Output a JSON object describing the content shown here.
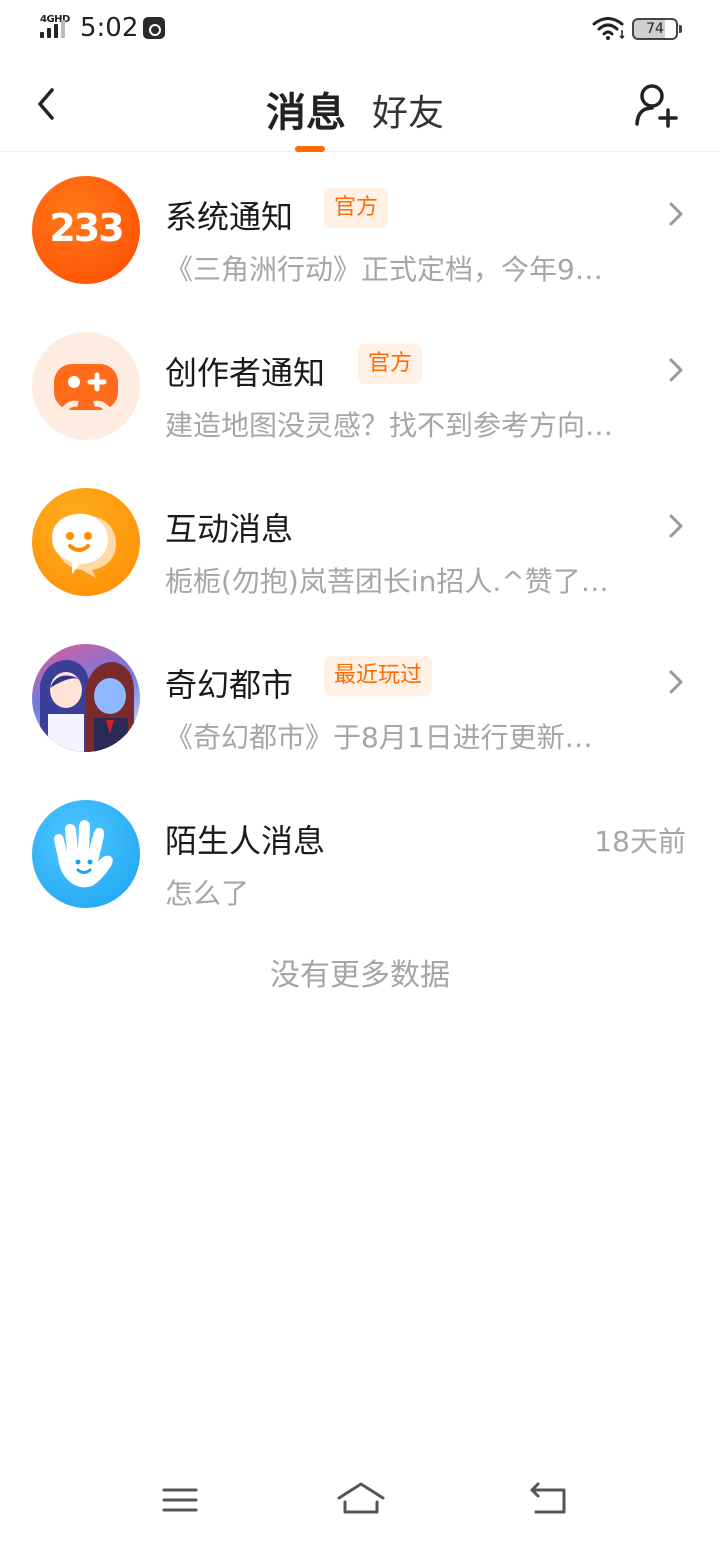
{
  "status_bar": {
    "network": "4GHD",
    "time": "5:02",
    "battery": "74"
  },
  "header": {
    "tabs": [
      {
        "label": "消息",
        "active": true
      },
      {
        "label": "好友",
        "active": false
      }
    ],
    "accent_color": "#ff6b00",
    "icons": {
      "back": "chevron-left-icon",
      "add_friend": "add-user-icon"
    }
  },
  "messages": [
    {
      "title": "系统通知",
      "tag": "官方",
      "preview": "《三角洲行动》正式定档，今年9…",
      "avatar_text": "233",
      "avatar_icon": "233-logo-icon"
    },
    {
      "title": "创作者通知",
      "tag": "官方",
      "preview": "建造地图没灵感？找不到参考方向…",
      "avatar_icon": "gamepad-icon"
    },
    {
      "title": "互动消息",
      "tag": "",
      "preview": "栀栀(勿抱)岚菩团长in招人.^赞了…",
      "avatar_icon": "chat-bubble-icon"
    },
    {
      "title": "奇幻都市",
      "tag": "最近玩过",
      "preview": "《奇幻都市》于8月1日进行更新…",
      "avatar_icon": "game-characters-avatar"
    },
    {
      "title": "陌生人消息",
      "tag": "",
      "preview": "怎么了",
      "time": "18天前",
      "avatar_icon": "waving-hand-icon"
    }
  ],
  "footer_text": "没有更多数据",
  "system_nav": {
    "menu_icon": "menu-icon",
    "home_icon": "home-icon",
    "back_icon": "return-icon"
  }
}
